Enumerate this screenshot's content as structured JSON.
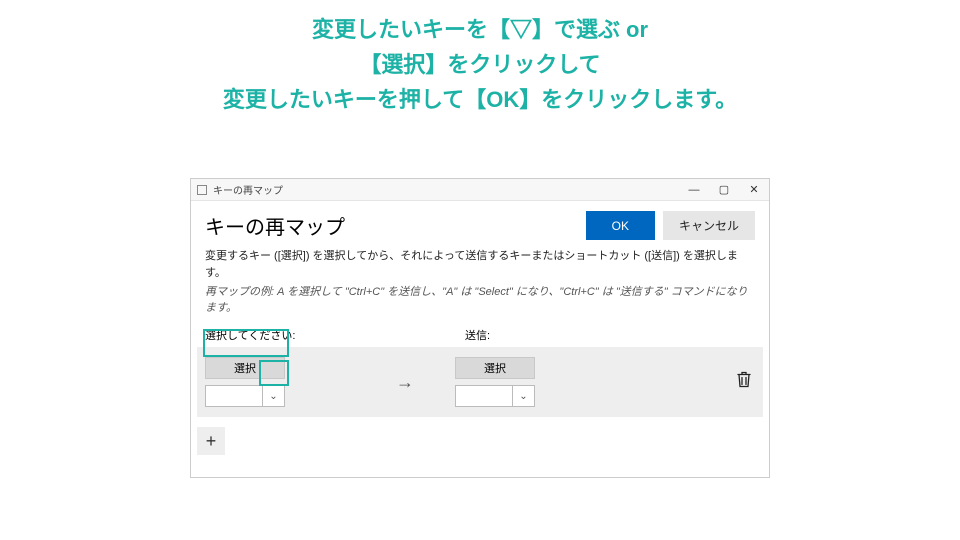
{
  "instruction": {
    "line1": "変更したいキーを【▽】で選ぶ or",
    "line2": "【選択】をクリックして",
    "line3": "変更したいキーを押して【OK】をクリックします。"
  },
  "window": {
    "titlebar_text": "キーの再マップ",
    "dialog_title": "キーの再マップ",
    "ok_label": "OK",
    "cancel_label": "キャンセル",
    "description": "変更するキー ([選択]) を選択してから、それによって送信するキーまたはショートカット ([送信]) を選択します。",
    "example": "再マップの例: A を選択して \"Ctrl+C\" を送信し、\"A\" は \"Select\" になり、\"Ctrl+C\" は \"送信する\" コマンドになります。",
    "col_label_left": "選択してください:",
    "col_label_right": "送信:",
    "select_btn_left": "選択",
    "select_btn_right": "選択",
    "arrow": "→",
    "add_label": "+"
  }
}
